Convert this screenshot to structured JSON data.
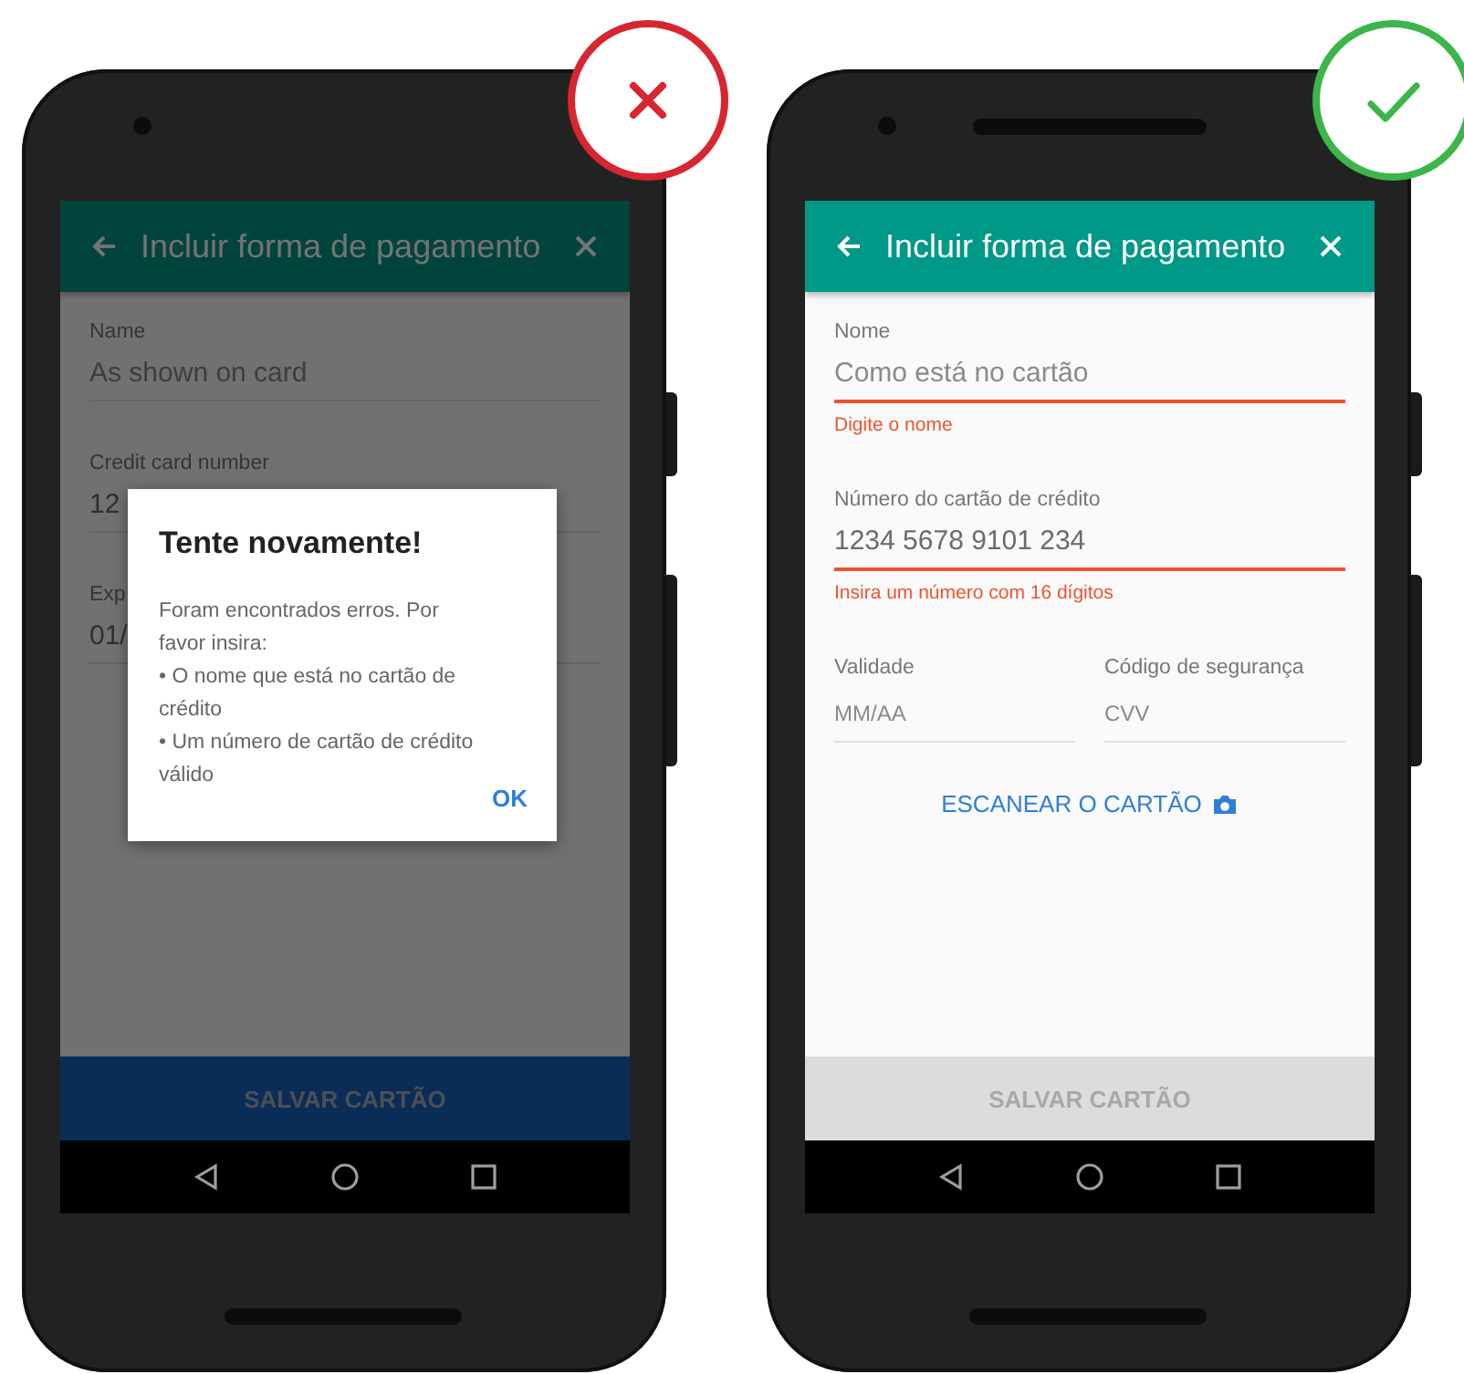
{
  "phones": [
    {
      "correct": false,
      "earpiece": false,
      "app_bar": {
        "title": "Incluir forma de pagamento"
      },
      "rows": [
        [
          {
            "label": "Name",
            "placeholder": "As shown on card"
          }
        ],
        [
          {
            "label": "Credit card number",
            "value": "12"
          }
        ],
        [
          {
            "label": "Exp",
            "value": "01/"
          }
        ]
      ],
      "save_button": {
        "label": "SALVAR CARTÃO",
        "disabled": false
      },
      "dialog": {
        "title": "Tente novamente!",
        "lines": [
          "Foram encontrados erros. Por favor insira:",
          "• O nome que está no cartão de crédito",
          "• Um número de cartão de crédito válido"
        ],
        "action": "OK"
      }
    },
    {
      "correct": true,
      "earpiece": true,
      "app_bar": {
        "title": "Incluir forma de pagamento"
      },
      "rows": [
        [
          {
            "label": "Nome",
            "placeholder": "Como está no cartão",
            "error": "Digite o nome"
          }
        ],
        [
          {
            "label": "Número do cartão de crédito",
            "value": "1234 5678 9101 234",
            "error": "Insira um número com 16 dígitos"
          }
        ],
        [
          {
            "label": "Validade",
            "placeholder": "MM/AA"
          },
          {
            "label": "Código de segurança",
            "placeholder": "CVV"
          }
        ]
      ],
      "scan_link": "ESCANEAR O CARTÃO",
      "save_button": {
        "label": "SALVAR CARTÃO",
        "disabled": true
      }
    }
  ]
}
